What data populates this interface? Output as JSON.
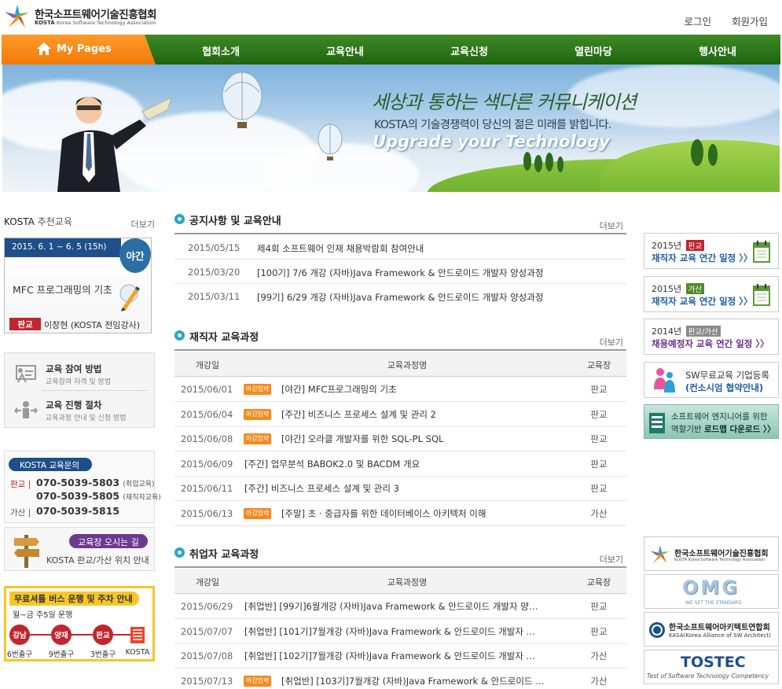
{
  "header": {
    "org_name": "한국소프트웨어기술진흥협회",
    "org_abbr": "KOSTA",
    "org_sub": "Korea Software Technology Association",
    "login": "로그인",
    "signup": "회원가입"
  },
  "nav": {
    "mypage": "My Pages",
    "items": [
      "협회소개",
      "교육안내",
      "교육신청",
      "열린마당",
      "행사안내"
    ]
  },
  "banner": {
    "script": "세상과 통하는 색다른 커뮤니케이션",
    "tagline": "KOSTA의 기술경쟁력이 당신의 젊은 미래를 밝힙니다.",
    "upgrade": "Upgrade your Technology"
  },
  "recommend": {
    "head_abbr": "KOSTA",
    "head": "추천교육",
    "more": "더보기",
    "date": "2015. 6. 1 ~ 6. 5 (15h)",
    "badge": "야간",
    "title": "MFC 프로그래밍의 기초",
    "location": "판교",
    "instructor": "이창현 (KOSTA 전임강사)"
  },
  "guide": {
    "items": [
      {
        "title": "교육 참여 방법",
        "sub": "교육참여 자격 및 방법"
      },
      {
        "title": "교육 진행 절차",
        "sub": "교육과정 안내 및 신청 방법"
      }
    ]
  },
  "inquiry": {
    "title": "KOSTA 교육문의",
    "pangyo": "판교",
    "phone1": "070-5039-5803",
    "phone1_note": "(취업교육)",
    "phone2": "070-5039-5805",
    "phone2_note": "(재직자교육)",
    "gasan": "가산",
    "phone3": "070-5039-5815"
  },
  "directions": {
    "title": "교육장 오시는 길",
    "desc": "KOSTA 판교/가산 위치 안내"
  },
  "bus": {
    "title": "무료셔틀 버스 운행 및 주차 안내",
    "schedule": "월~금 주5일 운행",
    "stops": [
      {
        "name": "강남",
        "exit": "6번출구"
      },
      {
        "name": "양재",
        "exit": "9번출구"
      },
      {
        "name": "판교",
        "exit": "3번출구"
      }
    ],
    "last": "KOSTA"
  },
  "notice": {
    "title": "공지사항 및 교육안내",
    "more": "더보기",
    "rows": [
      {
        "date": "2015/05/15",
        "title": "제4회 소프트웨어 인재 채용박람회 참여안내"
      },
      {
        "date": "2015/03/20",
        "title": "[100기] 7/6 개강 (자바)Java Framework & 안드로이드 개발자 양성과정"
      },
      {
        "date": "2015/03/11",
        "title": "[99기] 6/29 개강 (자바)Java Framework & 안드로이드 개발자 양성과정"
      }
    ]
  },
  "employed": {
    "title": "재직자 교육과정",
    "more": "더보기",
    "columns": [
      "개강일",
      "교육과정명",
      "교육장"
    ],
    "tag": "마감임박",
    "rows": [
      {
        "date": "2015/06/01",
        "closing": true,
        "name": "[야간] MFC프로그래밍의 기초",
        "place": "판교"
      },
      {
        "date": "2015/06/04",
        "closing": true,
        "name": "[주간] 비즈니스 프로세스 설계 및 관리 2",
        "place": "판교"
      },
      {
        "date": "2015/06/08",
        "closing": true,
        "name": "[야간] 오라클 개발자를 위한 SQL-PL SQL",
        "place": "판교"
      },
      {
        "date": "2015/06/09",
        "closing": false,
        "name": "[주간] 업무분석 BABOK2.0 및 BACDM 개요",
        "place": "판교"
      },
      {
        "date": "2015/06/11",
        "closing": false,
        "name": "[주간] 비즈니스 프로세스 설계 및 관리 3",
        "place": "판교"
      },
      {
        "date": "2015/06/13",
        "closing": true,
        "name": "[주말] 초 · 중급자를 위한 데이터베이스 아키텍처 이해",
        "place": "가산"
      }
    ]
  },
  "jobseeker": {
    "title": "취업자 교육과정",
    "more": "더보기",
    "columns": [
      "개강일",
      "교육과정명",
      "교육장"
    ],
    "tag": "마감임박",
    "rows": [
      {
        "date": "2015/06/29",
        "closing": false,
        "name": "[취업반] [99기]6월개강 (자바)Java Framework & 안드로이드 개발자 양…",
        "place": "판교"
      },
      {
        "date": "2015/07/07",
        "closing": false,
        "name": "[취업반] [101기]7월개강 (자바)Java Framework & 안드로이드 개발자 …",
        "place": "판교"
      },
      {
        "date": "2015/07/08",
        "closing": false,
        "name": "[취업반] [102기]7월개강 (자바)Java Framework & 안드로이드 개발자 …",
        "place": "가산"
      },
      {
        "date": "2015/07/13",
        "closing": true,
        "name": "[취업반] [103기]7월개강 (자바)Java Framework & 안드로이드 …",
        "place": "가산"
      }
    ]
  },
  "right": {
    "schedules": [
      {
        "year": "2015년",
        "tag": "판교",
        "tag_color": "#c0262d",
        "label": "재직자 교육 연간 일정 〉〉"
      },
      {
        "year": "2015년",
        "tag": "가산",
        "tag_color": "#4f8a2b",
        "label": "재직자 교육 연간 일정 〉〉"
      },
      {
        "year": "2014년",
        "tag": "판교/가산",
        "tag_color": "#8a8a8a",
        "label": "채용예정자 교육 연간 일정 〉〉"
      }
    ],
    "sw_a": "SW무료교육 기업등록",
    "sw_b": "(컨소시엄 협약안내)",
    "road_a": "소프트웨어 엔지니어를 위한",
    "road_b1": "역할기반 ",
    "road_b2": "로드맵 다운로드 〉〉",
    "partners": {
      "kosta_name": "한국소프트웨어기술진흥협회",
      "kosta_sub": "KOSTA Korea Software Technology Association",
      "omg": "OMG",
      "omg_sub": "WE SET THE STANDARD",
      "kasa_name": "한국소프트웨어아키텍트연합회",
      "kasa_sub": "KASA(Korea Alliance of SW Architect)",
      "tostec": "TOSTEC",
      "tostec_sub": "Test of Software Technology Competency"
    }
  }
}
